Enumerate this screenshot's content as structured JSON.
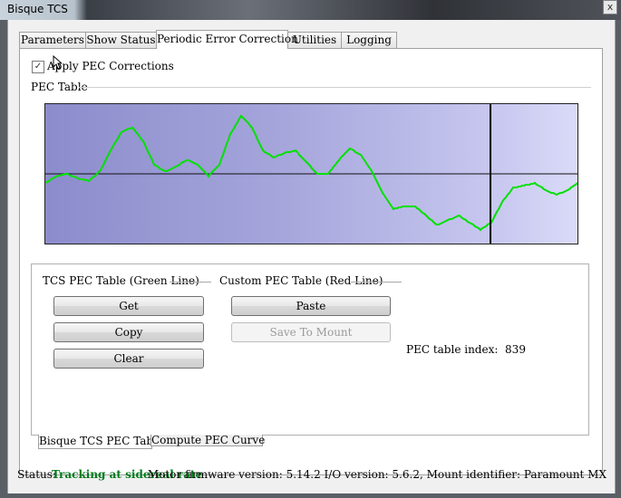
{
  "window": {
    "title": "Bisque TCS",
    "close_glyph": "x"
  },
  "tabs": [
    "Parameters",
    "Show Status",
    "Periodic Error Correction",
    "Utilities",
    "Logging"
  ],
  "apply_pec": {
    "label": "Apply PEC Corrections",
    "checked": true,
    "check_glyph": "✓"
  },
  "pec_table": {
    "group_label": "PEC Table",
    "chart_data": {
      "type": "line",
      "series": [
        {
          "color": "#00e000",
          "x": [
            0,
            12,
            24,
            36,
            48,
            60,
            72,
            84,
            96,
            108,
            120,
            132,
            144,
            156,
            168,
            180,
            192,
            204,
            216,
            228,
            240,
            252,
            264,
            276,
            288,
            300,
            312,
            324,
            336,
            348,
            360,
            372,
            384,
            396,
            408,
            420,
            432,
            444,
            456,
            468,
            480,
            492,
            504,
            516,
            528,
            540,
            552,
            564,
            576,
            587
          ],
          "y": [
            -0.2,
            -0.05,
            0.0,
            -0.1,
            -0.15,
            0.05,
            0.5,
            0.9,
            1.0,
            0.7,
            0.2,
            0.05,
            0.15,
            0.3,
            0.2,
            -0.05,
            0.2,
            0.85,
            1.25,
            1.0,
            0.5,
            0.35,
            0.45,
            0.5,
            0.25,
            0.0,
            0.0,
            0.3,
            0.55,
            0.4,
            0.05,
            -0.4,
            -0.75,
            -0.7,
            -0.7,
            -0.9,
            -1.1,
            -1.0,
            -0.9,
            -1.05,
            -1.2,
            -1.05,
            -0.6,
            -0.3,
            -0.25,
            -0.2,
            -0.35,
            -0.45,
            -0.35,
            -0.2
          ]
        }
      ],
      "ylim": [
        -1.5,
        1.5
      ],
      "xlim": [
        0,
        587
      ],
      "marker_x": 491,
      "zero_line": true,
      "background": "gradient"
    }
  },
  "tcs_group": {
    "label": "TCS PEC Table (Green Line)",
    "buttons": {
      "get": "Get",
      "copy": "Copy",
      "clear": "Clear"
    }
  },
  "custom_group": {
    "label": "Custom PEC Table (Red Line)",
    "buttons": {
      "paste": "Paste",
      "save": "Save To Mount"
    }
  },
  "pec_index": {
    "label": "PEC table index:",
    "value": "839"
  },
  "subtabs": [
    "Bisque TCS PEC Table",
    "Compute PEC Curve"
  ],
  "status": {
    "label": "Status:",
    "value": "Tracking at sidereal rate",
    "firmware": "Motor firmware version: 5.14.2   I/O version: 5.6.2, Mount identifier: Paramount MX"
  }
}
